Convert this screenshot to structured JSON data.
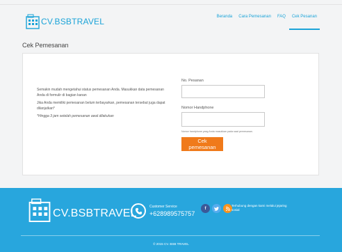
{
  "brand": {
    "name": "CV.BSBTRAVEL"
  },
  "nav": {
    "items": [
      "Beranda",
      "Cara Pemesanan",
      "FAQ",
      "Cek Pesanan"
    ],
    "active": "Cek Pesanan"
  },
  "page": {
    "title": "Cek Pemesanan"
  },
  "info": {
    "p1": "Semakin mudah mengetahui status pemesanan Anda. Masukkan data pemesanan Anda di formulir di bagian kanan",
    "p2": "Jika Anda memiliki pemesanan belum terbayarkan, pemesanan tersebut juga dapat dilanjutkan*",
    "note": "*Hingga 3 jam setelah pemesanan awal dilakukan"
  },
  "form": {
    "order_label": "No. Pesanan",
    "phone_label": "Nomor Handphone",
    "phone_help": "Nomor handphone yang Anda masukkan pada saat pemesanan.",
    "submit": "Cek pemesanan"
  },
  "footer": {
    "cs_label": "Customer Service",
    "cs_number": "+628989575757",
    "social_text": "Terhubung dengan kami melalui jejaring sosial",
    "copyright": "© 2015 CV. BSB TRAVEL",
    "icons": [
      "facebook-icon",
      "twitter-icon",
      "rss-icon"
    ]
  },
  "colors": {
    "accent": "#1aa3d8",
    "footer_bg": "#28a6dd",
    "button": "#f07a1a"
  }
}
